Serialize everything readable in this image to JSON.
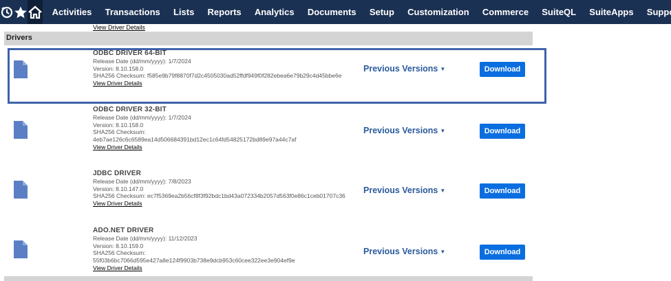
{
  "nav": {
    "icons": [
      "recent-icon",
      "star-icon",
      "home-icon"
    ],
    "items": [
      "Activities",
      "Transactions",
      "Lists",
      "Reports",
      "Analytics",
      "Documents",
      "Setup",
      "Customization",
      "Commerce",
      "SuiteQL",
      "SuiteApps",
      "Support"
    ]
  },
  "previous_section_tail": {
    "link": "View Driver Details"
  },
  "section": {
    "title": "Drivers"
  },
  "drivers": [
    {
      "name": "ODBC DRIVER 64-BIT",
      "release": "Release Date (dd/mm/yyyy): 1/7/2024",
      "version": "Version: 8.10.158.0",
      "checksum_label": "SHA256 Checksum:",
      "checksum": "f585e9b79f8870f7d2c4505030ad52ffdf949f0f282ebea6e79b29c4d45bbe6e",
      "details": "View Driver Details",
      "previous": "Previous Versions",
      "download": "Download"
    },
    {
      "name": "ODBC DRIVER 32-BIT",
      "release": "Release Date (dd/mm/yyyy): 1/7/2024",
      "version": "Version: 8.10.158.0",
      "checksum_label": "SHA256 Checksum:",
      "checksum": "4eb7ae126c6c6589ea14d506684391bd12ec1c64fd54825172bd89e97a44c7af",
      "details": "View Driver Details",
      "previous": "Previous Versions",
      "download": "Download"
    },
    {
      "name": "JDBC DRIVER",
      "release": "Release Date (dd/mm/yyyy): 7/8/2023",
      "version": "Version: 8.10.147.0",
      "checksum_label": "SHA256 Checksum:",
      "checksum": "ec7f5369ea2b56cf8f3f92bdc1bd43a072334b2057d563f0e86c1ceb01707c36",
      "details": "View Driver Details",
      "previous": "Previous Versions",
      "download": "Download"
    },
    {
      "name": "ADO.NET DRIVER",
      "release": "Release Date (dd/mm/yyyy): 11/12/2023",
      "version": "Version: 8.10.159.0",
      "checksum_label": "SHA256 Checksum:",
      "checksum": "55f03b6bc7066d595e427a8e124f9903b738e9dcb953c60cee322ee3e904ef9e",
      "details": "View Driver Details",
      "previous": "Previous Versions",
      "download": "Download"
    }
  ],
  "colors": {
    "nav_bg": "#1b3153",
    "accent": "#0b6ee0",
    "link": "#2a5a9c",
    "highlight": "#3f62a8"
  }
}
